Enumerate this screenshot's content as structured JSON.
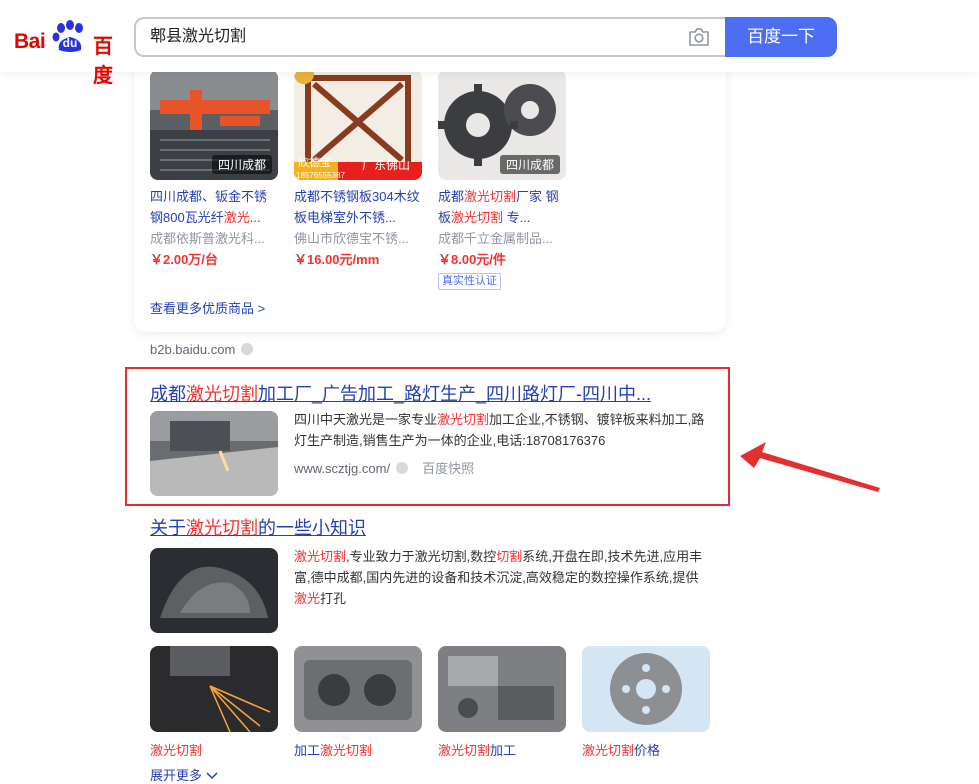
{
  "search": {
    "query": "郫县激光切割",
    "button_label": "百度一下"
  },
  "logo": {
    "bai": "Bai",
    "du": "du",
    "cn": "百度"
  },
  "products": [
    {
      "location": "四川成都",
      "title_pre": "四川成都、钣金不锈钢800瓦光纤",
      "title_hl": "激光",
      "title_post": "...",
      "seller": "成都依斯普激光科...",
      "price": "￥2.00万/台"
    },
    {
      "location": "广东佛山",
      "brand_tag": "欣德宝",
      "phone_tag": "18576555387",
      "title_pre": "成都不锈钢板304木纹板电梯室外不锈...",
      "title_hl": "",
      "title_post": "",
      "seller": "佛山市欣德宝不锈...",
      "price": "￥16.00元/mm"
    },
    {
      "location": "四川成都",
      "title_pre": "成都",
      "title_hl": "激光切割",
      "title_post": "厂家 钢板",
      "title_hl2": "激光切割",
      "title_post2": " 专...",
      "seller": "成都千立金属制品...",
      "price": "￥8.00元/件",
      "badge": "真实性认证"
    }
  ],
  "more_goods": "查看更多优质商品 >",
  "source1": "b2b.baidu.com",
  "result1": {
    "title_pre": "成都",
    "title_hl": "激光切割",
    "title_post": "加工厂_广告加工_路灯生产_四川路灯厂-四川中...",
    "desc_pre": "四川中天激光是一家专业",
    "desc_hl": "激光切割",
    "desc_post": "加工企业,不锈钢、镀锌板来料加工,路灯生产制造,销售生产为一体的企业,电话:18708176376",
    "url": "www.scztjg.com/",
    "snapshot": "百度快照"
  },
  "result2": {
    "title_pre": "关于",
    "title_hl": "激光切割",
    "title_post": "的一些小知识",
    "desc": [
      {
        "t": "激光切割",
        "hl": true
      },
      {
        "t": ",专业致力于激光切割,数控",
        "hl": false
      },
      {
        "t": "切割",
        "hl": true
      },
      {
        "t": "系统,开盘在即,技术先进,应用丰富,德中成都,国内先进的设备和技术沉淀,高效稳定的数控操作系统,提供",
        "hl": false
      },
      {
        "t": "激光",
        "hl": true
      },
      {
        "t": "打孔",
        "hl": false
      }
    ],
    "thumbs": [
      {
        "hl": "激光切割",
        "post": ""
      },
      {
        "pre": "加工",
        "hl": "激光切割",
        "post": ""
      },
      {
        "hl": "激光切割",
        "post": "加工"
      },
      {
        "hl": "激光切割",
        "post": "价格"
      }
    ],
    "expand": "展开更多"
  },
  "colors": {
    "accent": "#4e6ef2",
    "link": "#2440b3",
    "highlight": "#f73131",
    "annotation": "#e42f2f"
  }
}
